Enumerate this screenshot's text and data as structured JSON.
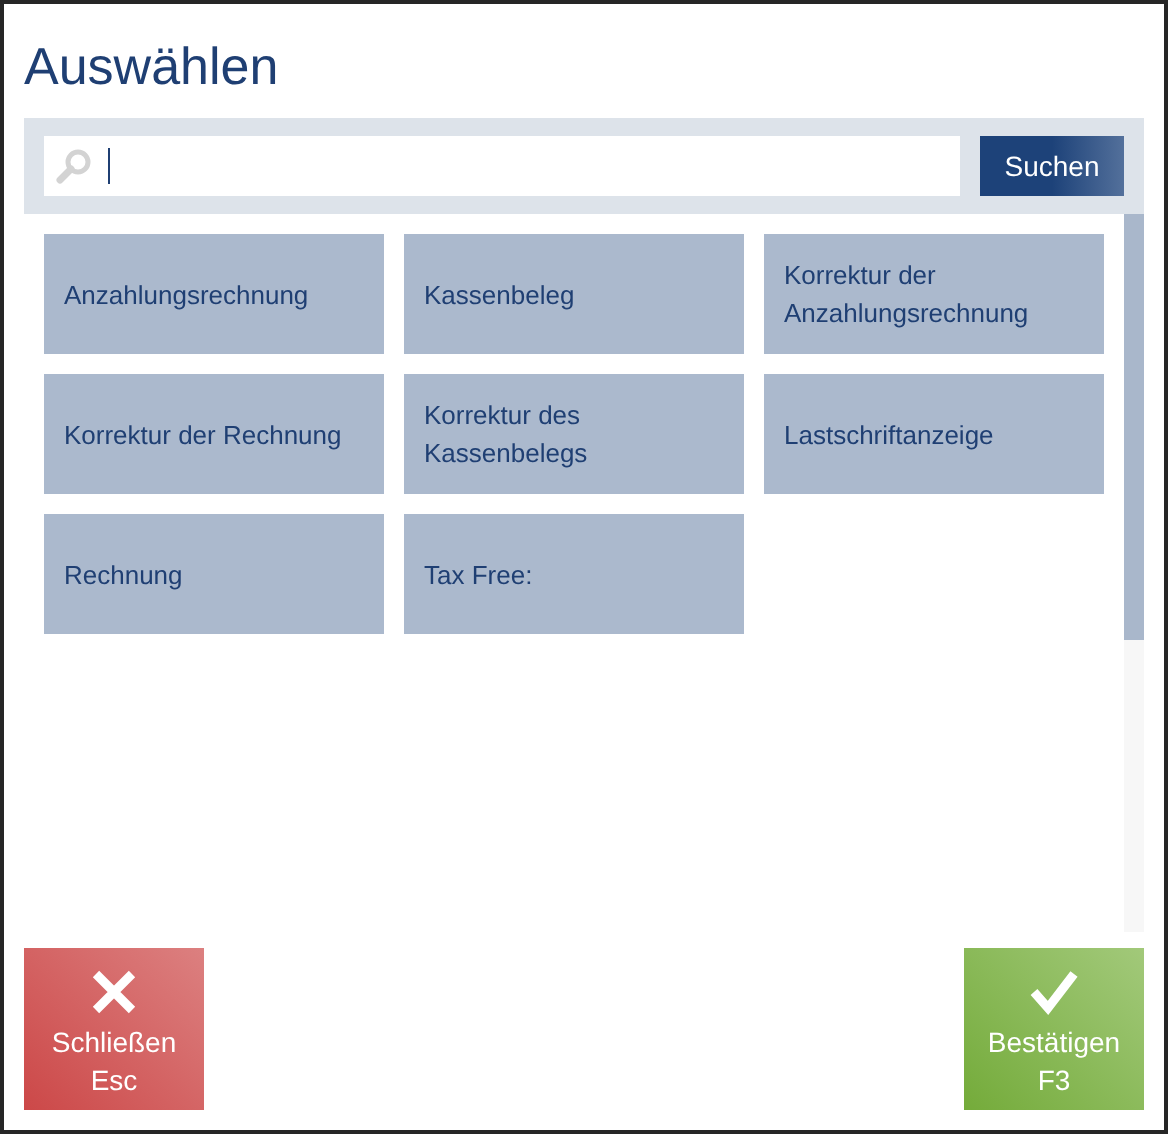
{
  "title": "Auswählen",
  "search": {
    "button": "Suchen"
  },
  "tiles": [
    {
      "label": "Anzahlungsrechnung"
    },
    {
      "label": "Kassenbeleg"
    },
    {
      "label": "Korrektur der Anzahlungsrechnung"
    },
    {
      "label": "Korrektur der Rechnung"
    },
    {
      "label": "Korrektur des Kassenbelegs"
    },
    {
      "label": "Lastschriftanzeige"
    },
    {
      "label": "Rechnung"
    },
    {
      "label": "Tax Free:"
    }
  ],
  "buttons": [
    {
      "kind": "close",
      "label": "Schließen",
      "shortcut": "Esc"
    },
    {
      "kind": "confirm",
      "label": "Bestätigen",
      "shortcut": "F3"
    }
  ]
}
